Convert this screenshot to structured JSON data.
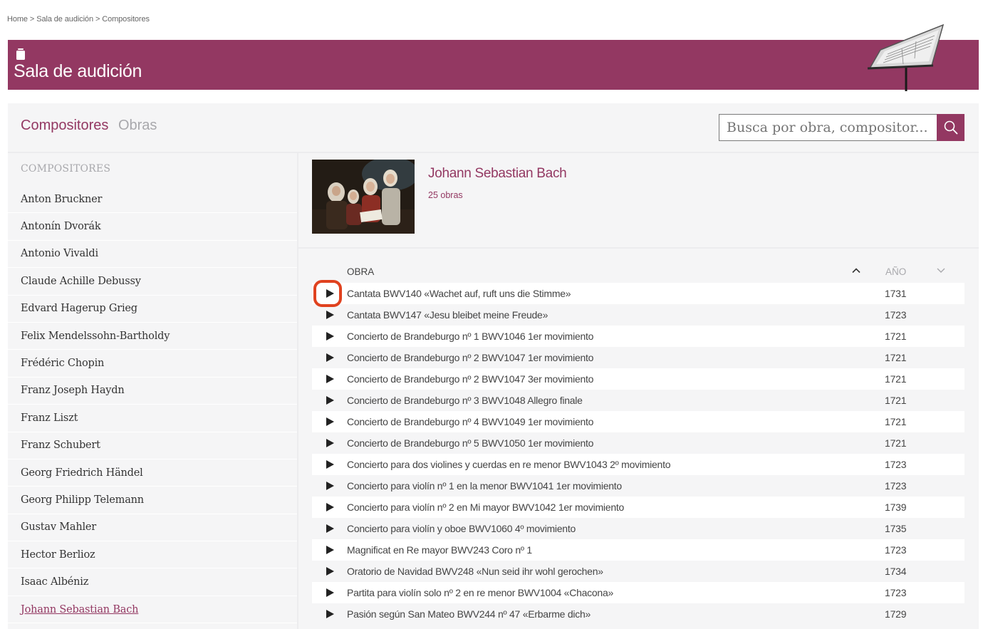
{
  "breadcrumb": [
    "Home",
    "Sala de audición",
    "Compositores"
  ],
  "breadcrumb_separator": ">",
  "banner": {
    "title": "Sala de audición",
    "color": "#933862"
  },
  "tabs": [
    {
      "label": "Compositores",
      "active": true
    },
    {
      "label": "Obras",
      "active": false
    }
  ],
  "search": {
    "placeholder": "Busca por obra, compositor...",
    "icon": "search-icon"
  },
  "sidebar": {
    "heading": "COMPOSITORES",
    "items": [
      {
        "label": "Anton Bruckner"
      },
      {
        "label": "Antonín Dvorák"
      },
      {
        "label": "Antonio Vivaldi"
      },
      {
        "label": "Claude Achille Debussy"
      },
      {
        "label": "Edvard Hagerup Grieg"
      },
      {
        "label": "Felix Mendelssohn-Bartholdy"
      },
      {
        "label": "Frédéric Chopin"
      },
      {
        "label": "Franz Joseph Haydn"
      },
      {
        "label": "Franz Liszt"
      },
      {
        "label": "Franz Schubert"
      },
      {
        "label": "Georg Friedrich Händel"
      },
      {
        "label": "Georg Philipp Telemann"
      },
      {
        "label": "Gustav Mahler"
      },
      {
        "label": "Hector Berlioz"
      },
      {
        "label": "Isaac Albéniz"
      },
      {
        "label": "Johann Sebastian Bach",
        "active": true
      }
    ]
  },
  "composer": {
    "name": "Johann Sebastian Bach",
    "count": "25 obras"
  },
  "table": {
    "col_obra": "OBRA",
    "col_ano": "AÑO",
    "rows": [
      {
        "title": "Cantata BWV140 «Wachet auf, ruft uns die Stimme»",
        "year": "1731"
      },
      {
        "title": "Cantata BWV147 «Jesu bleibet meine Freude»",
        "year": "1723"
      },
      {
        "title": "Concierto de Brandeburgo nº 1 BWV1046 1er movimiento",
        "year": "1721"
      },
      {
        "title": "Concierto de Brandeburgo nº 2 BWV1047 1er movimiento",
        "year": "1721"
      },
      {
        "title": "Concierto de Brandeburgo nº 2 BWV1047 3er movimiento",
        "year": "1721"
      },
      {
        "title": "Concierto de Brandeburgo nº 3 BWV1048 Allegro finale",
        "year": "1721"
      },
      {
        "title": "Concierto de Brandeburgo nº 4 BWV1049 1er movimiento",
        "year": "1721"
      },
      {
        "title": "Concierto de Brandeburgo nº 5 BWV1050 1er movimiento",
        "year": "1721"
      },
      {
        "title": "Concierto para dos violines y cuerdas en re menor BWV1043 2º movimiento",
        "year": "1723"
      },
      {
        "title": "Concierto para violín nº 1 en la menor BWV1041 1er movimiento",
        "year": "1723"
      },
      {
        "title": "Concierto para violín nº 2 en Mi mayor BWV1042 1er movimiento",
        "year": "1739"
      },
      {
        "title": "Concierto para violín y oboe BWV1060 4º movimiento",
        "year": "1735"
      },
      {
        "title": "Magnificat en Re mayor BWV243 Coro nº 1",
        "year": "1723"
      },
      {
        "title": "Oratorio de Navidad BWV248 «Nun seid ihr wohl gerochen»",
        "year": "1734"
      },
      {
        "title": "Partita para violín solo nº 2 en re menor BWV1004 «Chacona»",
        "year": "1723"
      },
      {
        "title": "Pasión según San Mateo BWV244 nº 47 «Erbarme dich»",
        "year": "1729"
      }
    ]
  },
  "highlight_color": "#e0421f"
}
